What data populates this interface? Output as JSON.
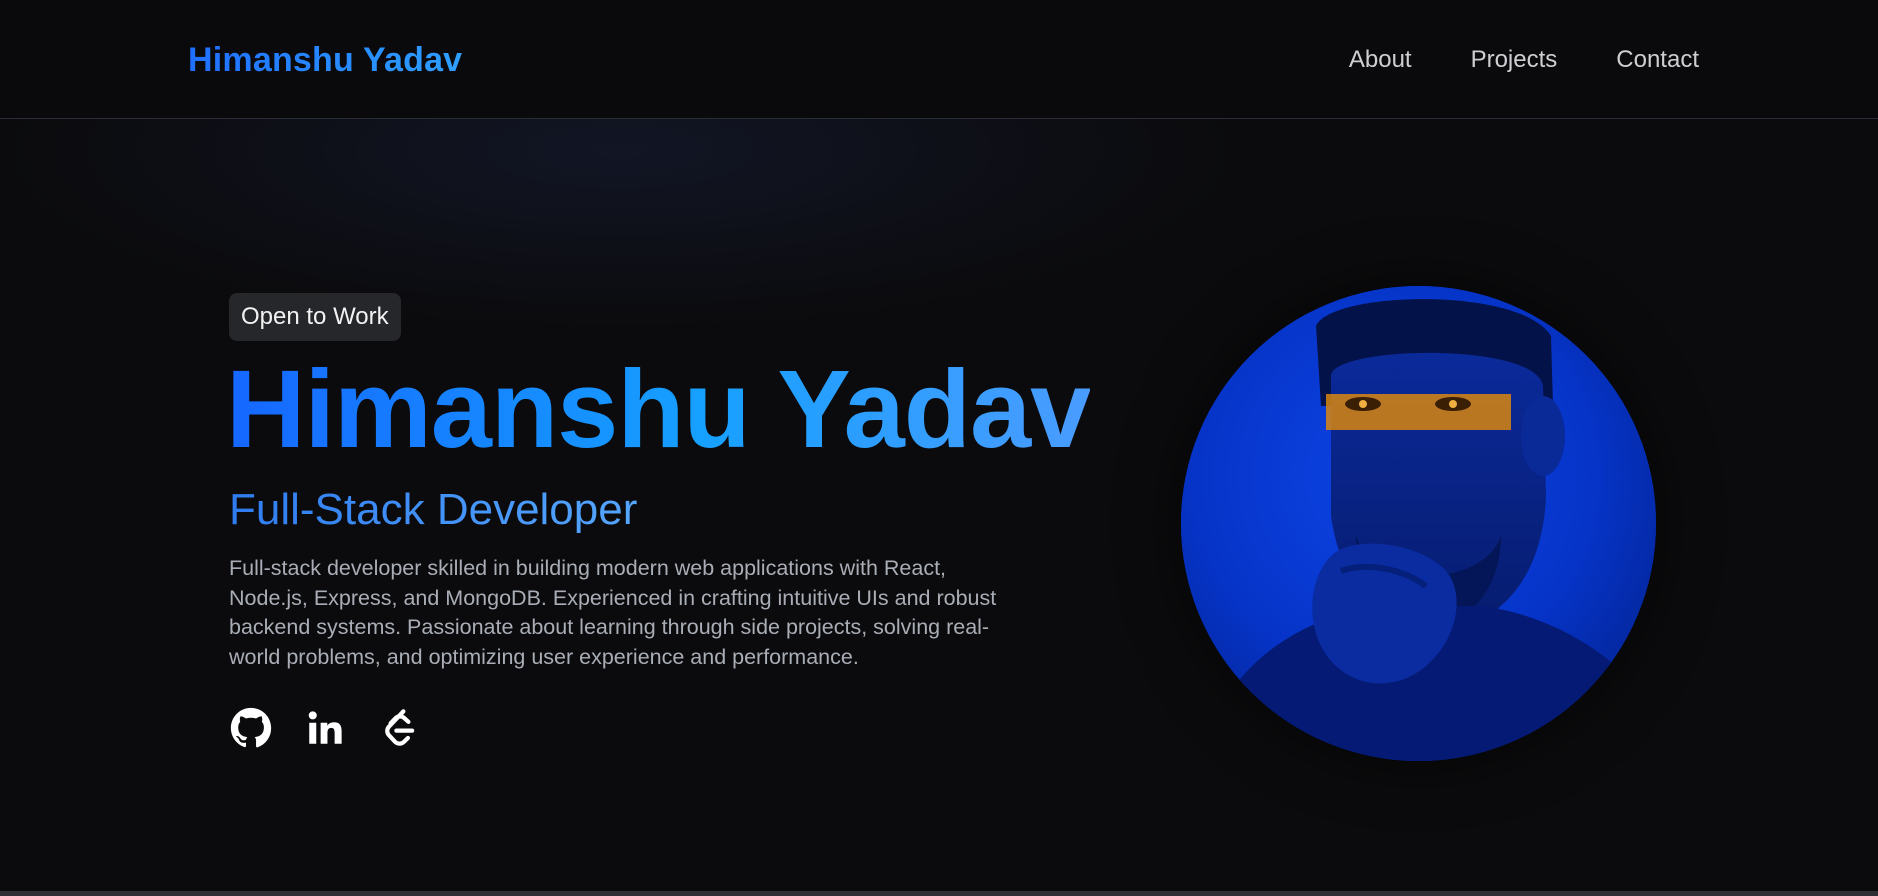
{
  "header": {
    "brand": "Himanshu Yadav",
    "nav": [
      "About",
      "Projects",
      "Contact"
    ]
  },
  "hero": {
    "badge": "Open to Work",
    "name": "Himanshu Yadav",
    "role": "Full-Stack Developer",
    "bio": "Full-stack developer skilled in building modern web applications with React, Node.js, Express, and MongoDB. Experienced in crafting intuitive UIs and robust backend systems. Passionate about learning through side projects, solving real-world problems, and optimizing user experience and performance.",
    "socials": [
      {
        "icon": "github-icon"
      },
      {
        "icon": "linkedin-icon"
      },
      {
        "icon": "leetcode-icon"
      }
    ]
  },
  "colors": {
    "background": "#0b0b0d",
    "accent_blue": "#1f6fff",
    "portrait_blue": "#0633c9",
    "eye_band": "#e08a10"
  }
}
